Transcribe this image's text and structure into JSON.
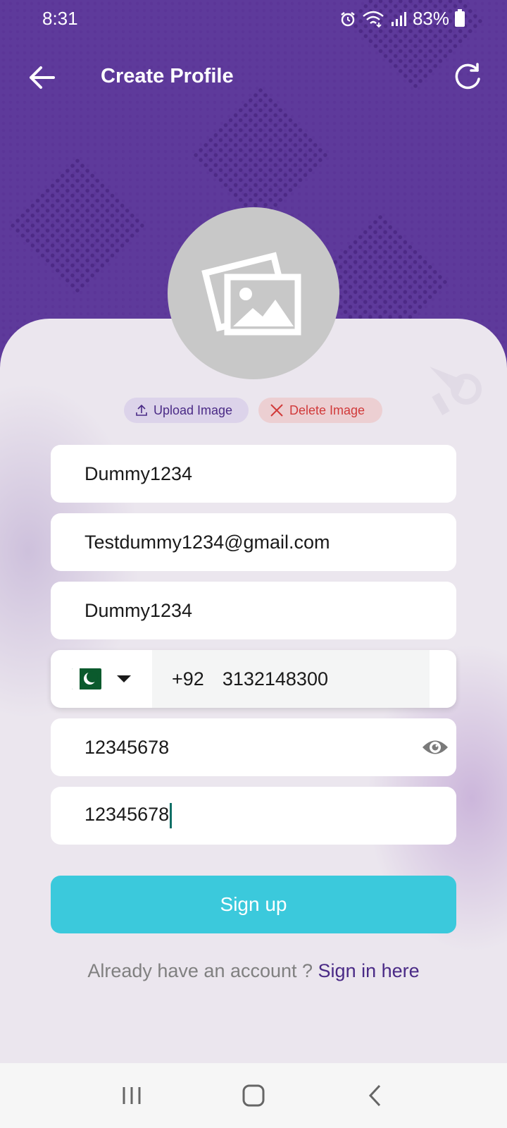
{
  "status_bar": {
    "time": "8:31",
    "battery": "83%"
  },
  "app_bar": {
    "title": "Create Profile"
  },
  "image_actions": {
    "upload_label": "Upload Image",
    "delete_label": "Delete Image"
  },
  "form": {
    "username": "Dummy1234",
    "email": "Testdummy1234@gmail.com",
    "name": "Dummy1234",
    "phone": {
      "country_flag": "pakistan-flag",
      "dial_code": "+92",
      "number": "3132148300"
    },
    "password": "12345678",
    "confirm_password": "12345678"
  },
  "signup_label": "Sign up",
  "signin": {
    "prompt": "Already have an account ? ",
    "link": "Sign in here"
  },
  "colors": {
    "header_purple": "#5e3a9b",
    "accent_teal": "#3bc9dc",
    "link_purple": "#4a2a86",
    "delete_red": "#d13a3a"
  }
}
